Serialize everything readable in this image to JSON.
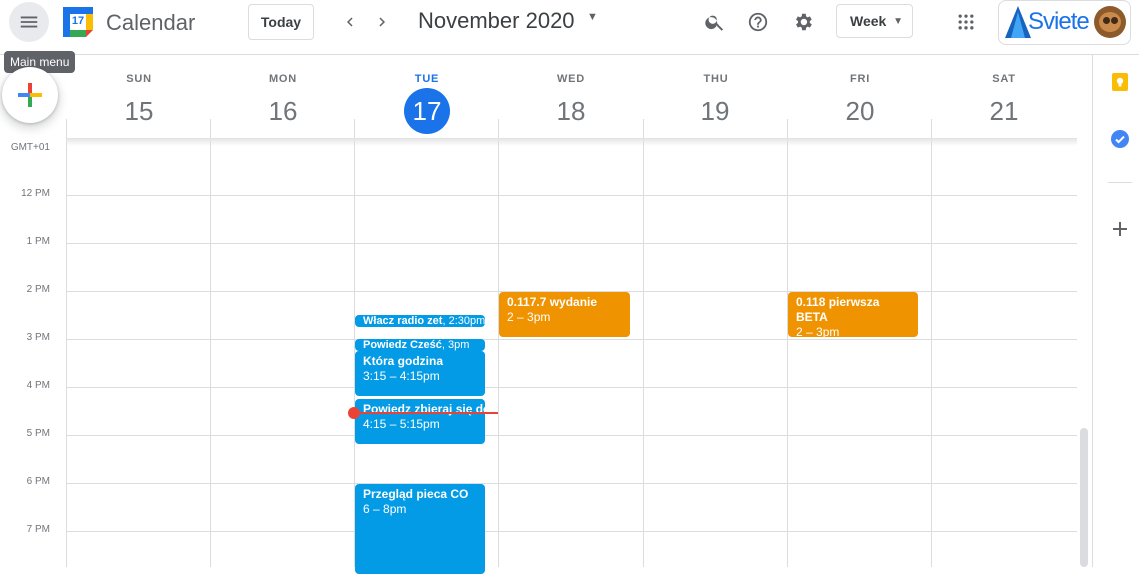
{
  "header": {
    "menu_tooltip": "Main menu",
    "app_title": "Calendar",
    "logo_day": "17",
    "today_label": "Today",
    "month_title": "November 2020",
    "view_label": "Week",
    "brand": "Sviete"
  },
  "days": [
    {
      "dow": "SUN",
      "num": "15"
    },
    {
      "dow": "MON",
      "num": "16"
    },
    {
      "dow": "TUE",
      "num": "17",
      "today": true
    },
    {
      "dow": "WED",
      "num": "18"
    },
    {
      "dow": "THU",
      "num": "19"
    },
    {
      "dow": "FRI",
      "num": "20"
    },
    {
      "dow": "SAT",
      "num": "21"
    }
  ],
  "timezone": "GMT+01",
  "times": [
    "12 PM",
    "1 PM",
    "2 PM",
    "3 PM",
    "4 PM",
    "5 PM",
    "6 PM",
    "7 PM"
  ],
  "events": {
    "radio": {
      "title": "Włacz radio zet",
      "time": "2:30pm"
    },
    "czesc": {
      "title": "Powiedz Cześć",
      "time": "3pm"
    },
    "godzina": {
      "title": "Która godzina",
      "time": "3:15 – 4:15pm"
    },
    "zbieraj": {
      "title": "Powiedz zbieraj się do",
      "time": "4:15 – 5:15pm"
    },
    "piec": {
      "title": "Przegląd pieca CO",
      "time": "6 – 8pm"
    },
    "wydanie": {
      "title": "0.117.7 wydanie",
      "time": "2 – 3pm"
    },
    "beta": {
      "title": "0.118 pierwsza BETA",
      "time": "2 – 3pm"
    }
  },
  "colors": {
    "today": "#1a73e8",
    "event_blue": "#039be5",
    "event_orange": "#f09300",
    "now_line": "#ea4335"
  }
}
